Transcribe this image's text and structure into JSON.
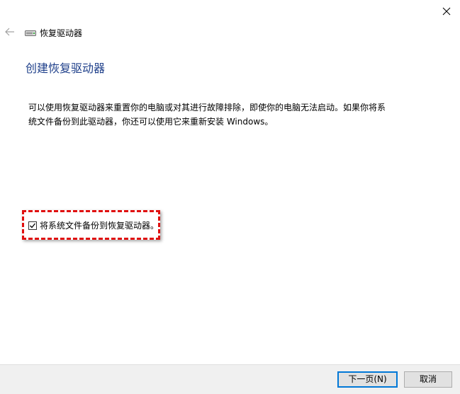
{
  "window": {
    "title": "恢复驱动器",
    "heading": "创建恢复驱动器",
    "description_lines": [
      "可以使用恢复驱动器来重置你的电脑或对其进行故障排除，即使你的电脑无法启动。如果你将系",
      "统文件备份到此驱动器，你还可以使用它来重新安装 Windows。"
    ],
    "checkbox": {
      "label": "将系统文件备份到恢复驱动器。",
      "checked": true
    },
    "buttons": {
      "next_label": "下一页(N)",
      "cancel_label": "取消"
    }
  },
  "icons": {
    "close": "close-icon",
    "back": "back-arrow-icon",
    "drive": "drive-icon",
    "check": "checkmark-icon"
  },
  "colors": {
    "heading": "#1e3f8a",
    "highlight": "#e01010",
    "footer_bg": "#f0f0f0",
    "focus": "#0078d7"
  }
}
